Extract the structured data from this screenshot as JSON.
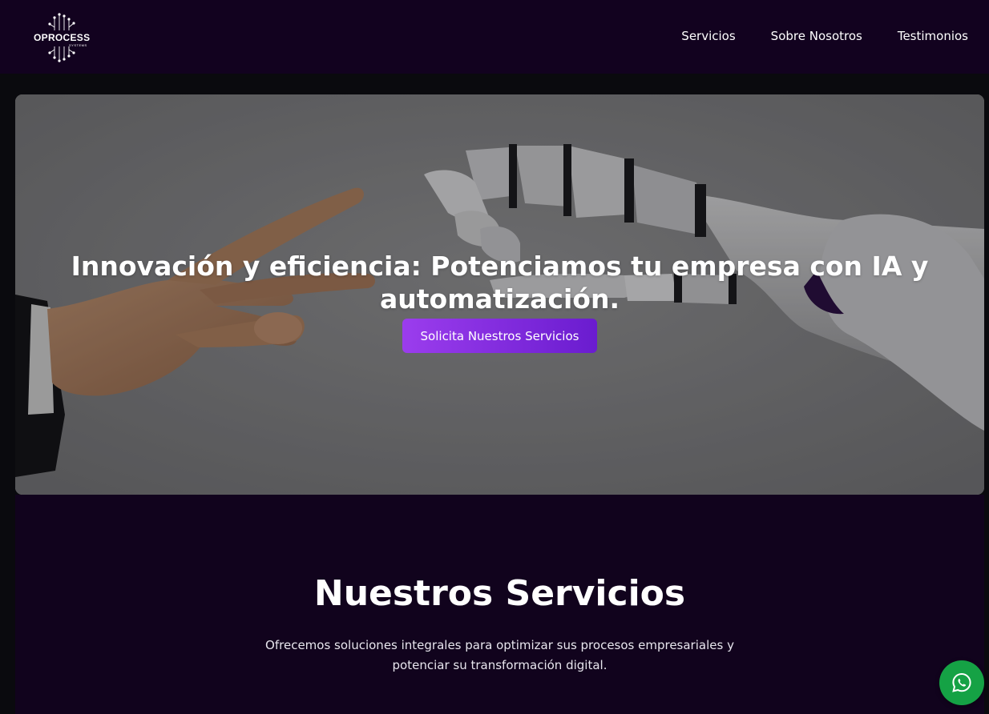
{
  "header": {
    "logo_text": "OPROCESS",
    "logo_subtext": "SYSTEMS",
    "nav": [
      {
        "label": "Servicios"
      },
      {
        "label": "Sobre Nosotros"
      },
      {
        "label": "Testimonios"
      }
    ]
  },
  "hero": {
    "title": "Innovación y eficiencia: Potenciamos tu empresa con IA y automatización.",
    "cta_label": "Solicita Nuestros Servicios"
  },
  "services": {
    "title": "Nuestros Servicios",
    "description": "Ofrecemos soluciones integrales para optimizar sus procesos empresariales y potenciar su transformación digital."
  },
  "icons": {
    "logo": "circuit-logo-icon",
    "whatsapp": "whatsapp-icon"
  },
  "colors": {
    "header_bg": "#12021f",
    "section_bg": "#11031d",
    "accent_start": "#9b3ded",
    "accent_end": "#6a1ccf",
    "whatsapp": "#15a245"
  }
}
